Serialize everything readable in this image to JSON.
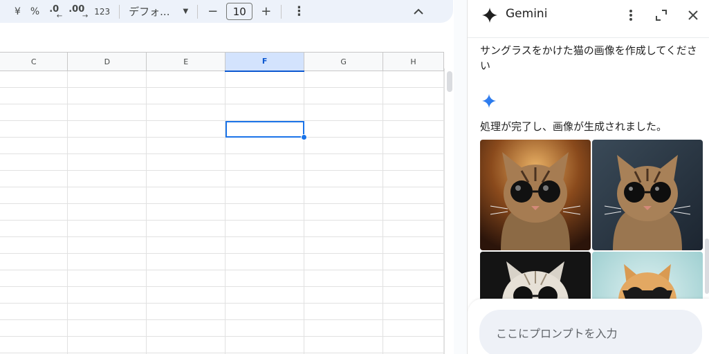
{
  "toolbar": {
    "yen": "¥",
    "percent": "%",
    "decrease_decimal": ".0",
    "increase_decimal": ".00",
    "number_format": "123",
    "font_family": "デフォ...",
    "font_size_minus": "−",
    "font_size": "10",
    "font_size_plus": "+",
    "more": "⋮",
    "collapse": "^"
  },
  "grid": {
    "columns": [
      "C",
      "D",
      "E",
      "F",
      "G",
      "H"
    ],
    "selected_column": "F",
    "row_count": 18
  },
  "gemini": {
    "title": "Gemini",
    "user_prompt": "サングラスをかけた猫の画像を作成してください",
    "response_text": "処理が完了し、画像が生成されました。",
    "input_placeholder": "ここにプロンプトを入力",
    "accent_color": "#1a73e8"
  }
}
